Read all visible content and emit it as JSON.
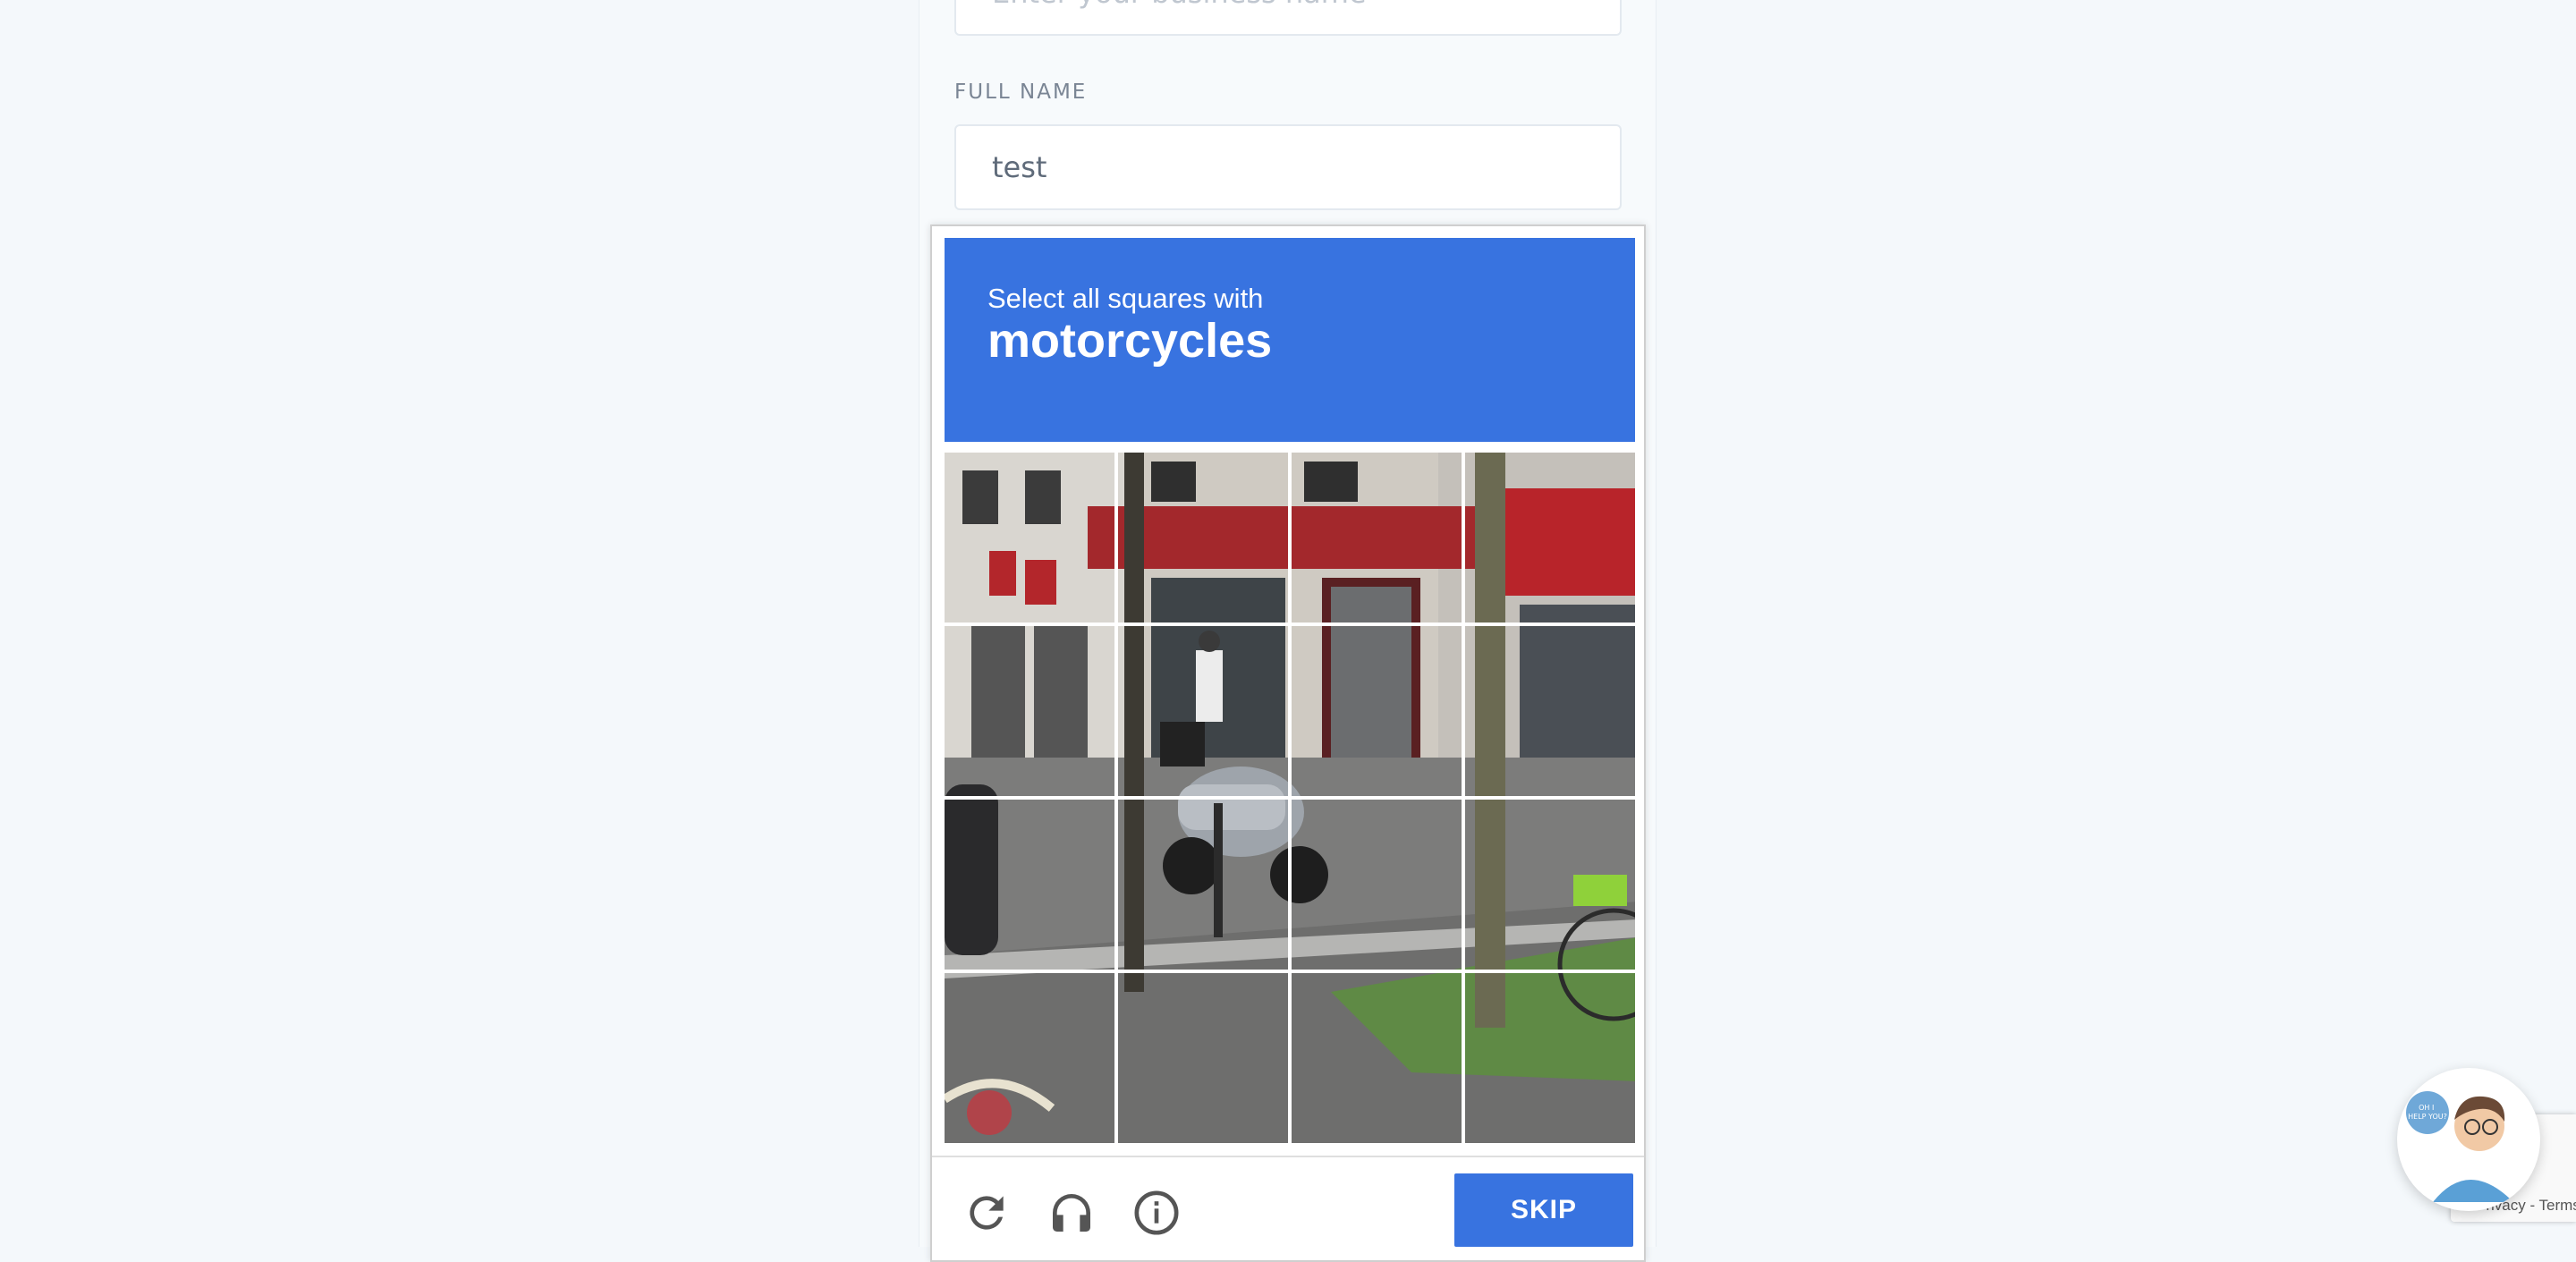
{
  "form": {
    "business_placeholder": "Enter your business name",
    "full_name_label": "FULL NAME",
    "full_name_value": "test"
  },
  "captcha": {
    "instruction": "Select all squares with",
    "target": "motorcycles",
    "tile_count": 16,
    "icons": {
      "reload": "reload-icon",
      "audio": "headphones-icon",
      "info": "info-icon"
    },
    "skip_label": "SKIP",
    "accent_color": "#3873e0"
  },
  "chat_widget": {
    "bubble_text": "OH I HELP YOU?"
  },
  "recaptcha_badge": {
    "links": "Privacy - Terms"
  }
}
